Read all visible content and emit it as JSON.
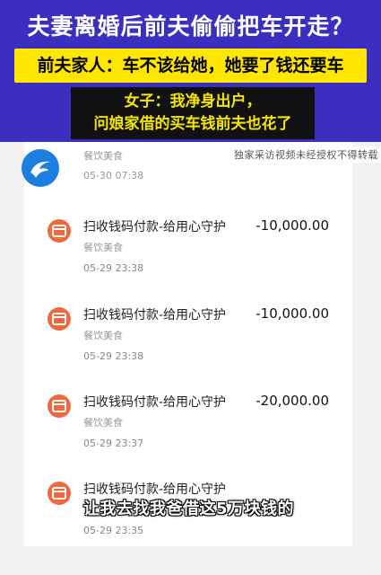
{
  "headline": "夫妻离婚后前夫偷偷把车开走？",
  "subhead": "前夫家人：车不该给她，她要了钱还要车",
  "quote": {
    "line1": "女子：我净身出户，",
    "line2": "问娘家借的买车钱前夫也花了"
  },
  "watermark": "独家采访视频未经授权不得转载",
  "partial_item": {
    "category": "餐饮美食",
    "time": "05-30 07:38"
  },
  "transactions": [
    {
      "title": "扫收钱码付款-给用心守护",
      "amount": "-10,000.00",
      "category": "餐饮美食",
      "time": "05-29 23:38"
    },
    {
      "title": "扫收钱码付款-给用心守护",
      "amount": "-10,000.00",
      "category": "餐饮美食",
      "time": "05-29 23:38"
    },
    {
      "title": "扫收钱码付款-给用心守护",
      "amount": "-20,000.00",
      "category": "餐饮美食",
      "time": "05-29 23:37"
    },
    {
      "title": "扫收钱码付款-给用心守护",
      "amount": "",
      "category": "",
      "time": "05-29 23:35"
    }
  ],
  "subtitle": "让我去找我爸借这5万块钱的",
  "colors": {
    "banner": "#3a2fbf",
    "subhead_bg": "#ffe600",
    "quote_text": "#f5e600",
    "tx_icon": "#f2683d",
    "logo": "#1c7ee0"
  }
}
